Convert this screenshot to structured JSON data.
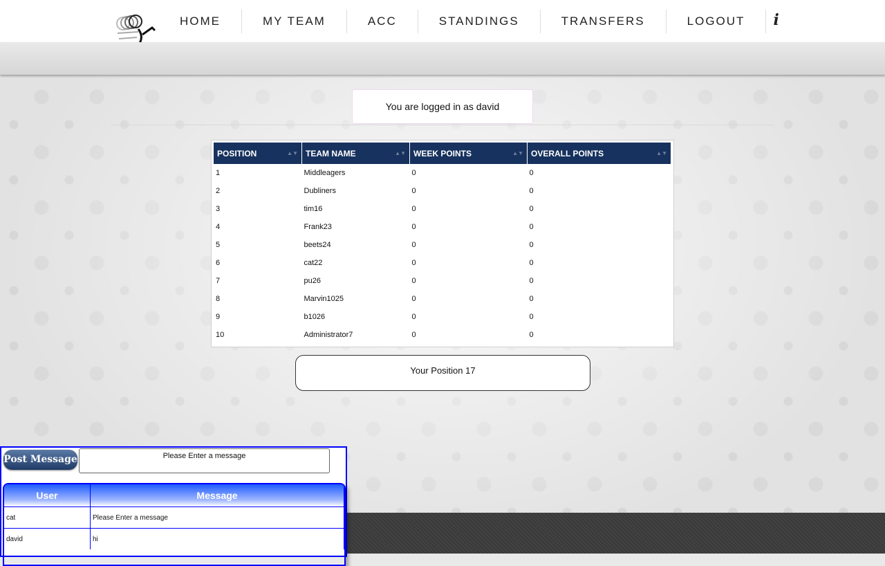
{
  "nav": {
    "items": [
      "HOME",
      "MY TEAM",
      "ACC",
      "STANDINGS",
      "TRANSFERS",
      "LOGOUT"
    ],
    "info_icon": "i"
  },
  "login_status": "You are logged in as david",
  "standings": {
    "headers": [
      "POSITION",
      "TEAM NAME",
      "WEEK POINTS",
      "OVERALL POINTS"
    ],
    "rows": [
      [
        "1",
        "Middleagers",
        "0",
        "0"
      ],
      [
        "2",
        "Dubliners",
        "0",
        "0"
      ],
      [
        "3",
        "tim16",
        "0",
        "0"
      ],
      [
        "4",
        "Frank23",
        "0",
        "0"
      ],
      [
        "5",
        "beets24",
        "0",
        "0"
      ],
      [
        "6",
        "cat22",
        "0",
        "0"
      ],
      [
        "7",
        "pu26",
        "0",
        "0"
      ],
      [
        "8",
        "Marvin1025",
        "0",
        "0"
      ],
      [
        "9",
        "b1026",
        "0",
        "0"
      ],
      [
        "10",
        "Administrator7",
        "0",
        "0"
      ]
    ],
    "your_position": "Your Position 17"
  },
  "chat": {
    "post_button": "Post Message",
    "input_value": "Please Enter a message",
    "headers": [
      "User",
      "Message"
    ],
    "rows": [
      [
        "cat",
        "Please Enter a message"
      ],
      [
        "david",
        "hi"
      ]
    ]
  }
}
